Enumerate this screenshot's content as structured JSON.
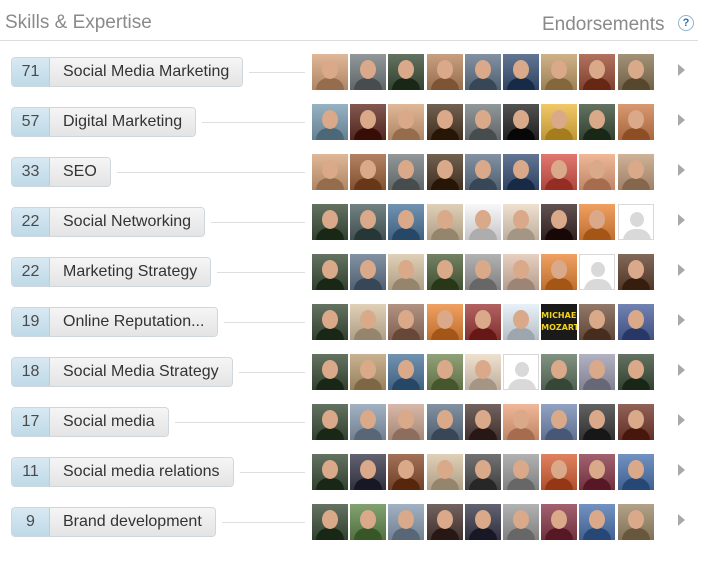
{
  "header": {
    "section_title": "Skills & Expertise",
    "endorsements_label": "Endorsements",
    "help_glyph": "?"
  },
  "skills": [
    {
      "count": "71",
      "name": "Social Media Marketing",
      "avatars": [
        "#b89070",
        "#6a6f72",
        "#3c4a3a",
        "#a07858",
        "#5a6a7a",
        "#3a4e6c",
        "#a88a60",
        "#8a4a38",
        "#7a6a50"
      ]
    },
    {
      "count": "57",
      "name": "Digital Marketing",
      "avatars": [
        "#6f8a9a",
        "#5a3028",
        "#b89070",
        "#4a3828",
        "#6a6f72",
        "#2a2a2a",
        "#c8a040",
        "#3c4a3a",
        "#b07048"
      ]
    },
    {
      "count": "33",
      "name": "SEO",
      "avatars": [
        "#b89070",
        "#8a5a3a",
        "#6a6f72",
        "#4a3828",
        "#5a6a7a",
        "#3a4e6c",
        "#b85048",
        "#c89070",
        "#a88a70"
      ]
    },
    {
      "count": "22",
      "name": "Social Networking",
      "avatars": [
        "#3c4a3a",
        "#4a5a5a",
        "#4a6a8a",
        "#b8a890",
        "#d0d0d0",
        "#c8b8a8",
        "#3a2a2a",
        "#c87838",
        "blank"
      ]
    },
    {
      "count": "22",
      "name": "Marketing Strategy",
      "avatars": [
        "#3c4a3a",
        "#5a6a7a",
        "#b8a890",
        "#4a5a3a",
        "#8a8a8a",
        "#c0a898",
        "#c87838",
        "blank",
        "#5a4030"
      ]
    },
    {
      "count": "19",
      "name": "Online Reputation...",
      "avatars": [
        "#3c4a3a",
        "#b8a890",
        "#8a6a5a",
        "#c87838",
        "#8a3a38",
        "#c0c8d0",
        "text",
        "#6a5040",
        "#4a5a8a"
      ]
    },
    {
      "count": "18",
      "name": "Social Media Strategy",
      "avatars": [
        "#3c4a3a",
        "#a08a68",
        "#4a6a8a",
        "#6a7a50",
        "#c8b8a8",
        "blank",
        "#5a6a5a",
        "#8a8a9a",
        "#3c4a3a"
      ]
    },
    {
      "count": "17",
      "name": "Social media",
      "avatars": [
        "#3c4a3a",
        "#7a8a9a",
        "#b09080",
        "#5a6a7a",
        "#4a3a38",
        "#c89070",
        "#6a7a9a",
        "#3a3a3a",
        "#6a3a30"
      ]
    },
    {
      "count": "11",
      "name": "Social media relations",
      "avatars": [
        "#3c4a3a",
        "#3a3a48",
        "#7a4a30",
        "#b8a890",
        "#4a4a4a",
        "#8a8a8a",
        "#b85a38",
        "#7a3a48",
        "#4a6a9a"
      ]
    },
    {
      "count": "9",
      "name": "Brand development",
      "avatars": [
        "#3c4a3a",
        "#5a7a4a",
        "#7a8a9a",
        "#4a3a38",
        "#3a3a48",
        "#8a8a8a",
        "#7a3a48",
        "#4a6a9a",
        "#8a7a60"
      ]
    }
  ],
  "blank_avatar_icon": "person-placeholder-icon",
  "text_avatar_lines": [
    "MICHAEL",
    "MOZART"
  ]
}
